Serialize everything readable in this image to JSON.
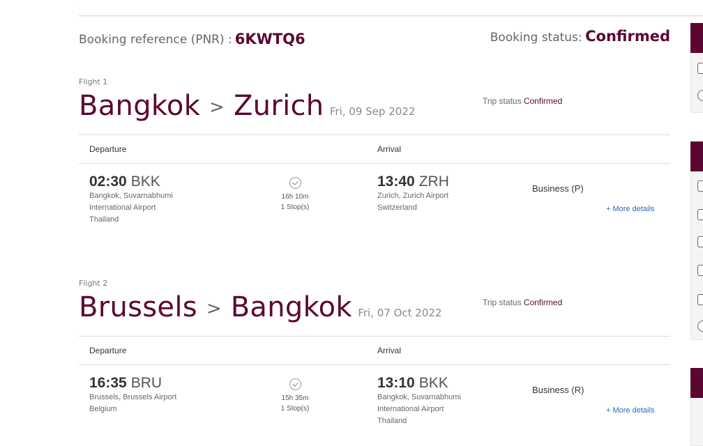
{
  "booking": {
    "pnr_label": "Booking reference (PNR) :",
    "pnr_value": "6KWTQ6",
    "status_label": "Booking status:",
    "status_value": "Confirmed"
  },
  "colors": {
    "brand": "#5c0632",
    "link": "#2a66b8"
  },
  "flights": [
    {
      "label": "Flight 1",
      "from_city": "Bangkok",
      "to_city": "Zurich",
      "date": "Fri, 09 Sep 2022",
      "trip_status_label": "Trip status",
      "trip_status_value": "Confirmed",
      "departure_header": "Departure",
      "arrival_header": "Arrival",
      "dep_time": "02:30",
      "dep_code": "BKK",
      "dep_airport_lines": [
        "Bangkok, Suvarnabhumi",
        "International Airport",
        "Thailand"
      ],
      "duration": "16h 10m",
      "stops": "1 Stop(s)",
      "arr_time": "13:40",
      "arr_code": "ZRH",
      "arr_airport_lines": [
        "Zurich, Zurich Airport",
        "Switzerland"
      ],
      "cabin": "Business (P)",
      "more_details": "+ More details"
    },
    {
      "label": "Flight 2",
      "from_city": "Brussels",
      "to_city": "Bangkok",
      "date": "Fri, 07 Oct 2022",
      "trip_status_label": "Trip status",
      "trip_status_value": "Confirmed",
      "departure_header": "Departure",
      "arrival_header": "Arrival",
      "dep_time": "16:35",
      "dep_code": "BRU",
      "dep_airport_lines": [
        "Brussels, Brussels Airport",
        "Belgium"
      ],
      "duration": "15h 35m",
      "stops": "1 Stop(s)",
      "arr_time": "13:10",
      "arr_code": "BKK",
      "arr_airport_lines": [
        "Bangkok, Suvarnabhumi",
        "International Airport",
        "Thailand"
      ],
      "cabin": "Business (R)",
      "more_details": "+ More details"
    }
  ],
  "sidebar": {
    "icons": [
      "printer-icon",
      "info-icon",
      "luggage-icon",
      "seat-icon",
      "calendar-icon",
      "upgrade-icon",
      "plane-icon",
      "meal-icon"
    ]
  }
}
